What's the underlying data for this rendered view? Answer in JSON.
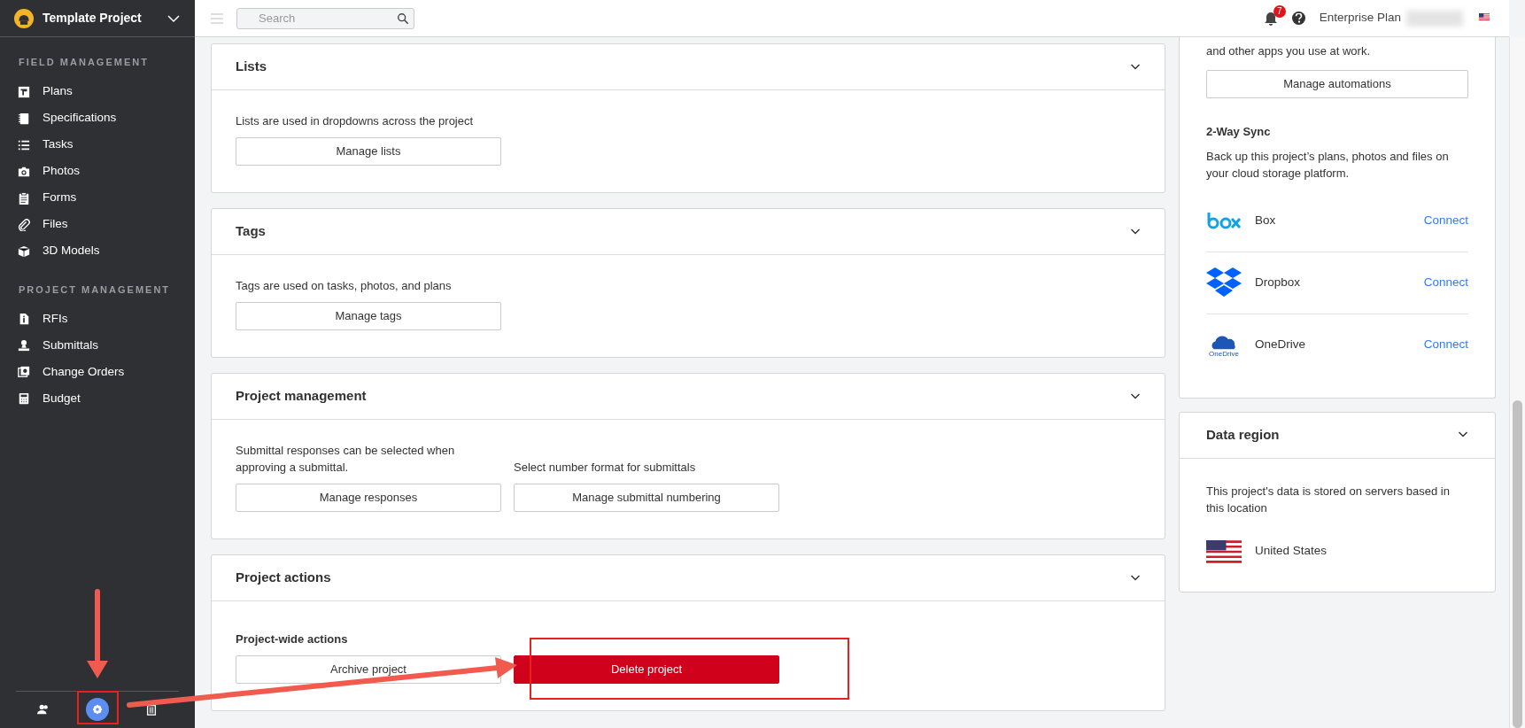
{
  "sidebar": {
    "project": "Template Project",
    "sections": [
      {
        "heading": "FIELD MANAGEMENT",
        "items": [
          {
            "label": "Plans"
          },
          {
            "label": "Specifications"
          },
          {
            "label": "Tasks"
          },
          {
            "label": "Photos"
          },
          {
            "label": "Forms"
          },
          {
            "label": "Files"
          },
          {
            "label": "3D Models"
          }
        ]
      },
      {
        "heading": "PROJECT MANAGEMENT",
        "items": [
          {
            "label": "RFIs"
          },
          {
            "label": "Submittals"
          },
          {
            "label": "Change Orders"
          },
          {
            "label": "Budget"
          }
        ]
      }
    ],
    "footer": [
      {
        "selected": false
      },
      {
        "selected": true
      },
      {
        "selected": false
      }
    ]
  },
  "topbar": {
    "search": {
      "placeholder": "Search"
    },
    "notifications": "7",
    "plan": "Enterprise Plan"
  },
  "cards": [
    {
      "title": "Lists",
      "columns": [
        {
          "text": "Lists are used in dropdowns across the project",
          "button": {
            "label": "Manage lists",
            "kind": "outline"
          }
        }
      ]
    },
    {
      "title": "Tags",
      "columns": [
        {
          "text": "Tags are used on tasks, photos, and plans",
          "button": {
            "label": "Manage tags",
            "kind": "outline"
          }
        }
      ]
    },
    {
      "title": "Project management",
      "columns": [
        {
          "text": "Submittal responses can be selected when approving a submittal.",
          "button": {
            "label": "Manage responses",
            "kind": "outline"
          }
        },
        {
          "text": "Select number format for submittals",
          "button": {
            "label": "Manage submittal numbering",
            "kind": "outline"
          }
        }
      ]
    },
    {
      "title": "Project actions",
      "subheading": "Project-wide actions",
      "columns": [
        {
          "button": {
            "label": "Archive project",
            "kind": "outline"
          }
        },
        {
          "button": {
            "label": "Delete project",
            "kind": "danger"
          }
        }
      ]
    }
  ],
  "integrations": {
    "text": "and other apps you use at work.",
    "button": "Manage automations",
    "sync_heading": "2-Way Sync",
    "sync_text": "Back up this project’s plans, photos and files on your cloud storage platform.",
    "services": [
      {
        "name": "Box",
        "action": "Connect"
      },
      {
        "name": "Dropbox",
        "action": "Connect"
      },
      {
        "name": "OneDrive",
        "logo_caption": "OneDrive",
        "action": "Connect"
      }
    ]
  },
  "data_region": {
    "title": "Data region",
    "text": "This project's data is stored on servers based in this location",
    "region": "United States"
  }
}
